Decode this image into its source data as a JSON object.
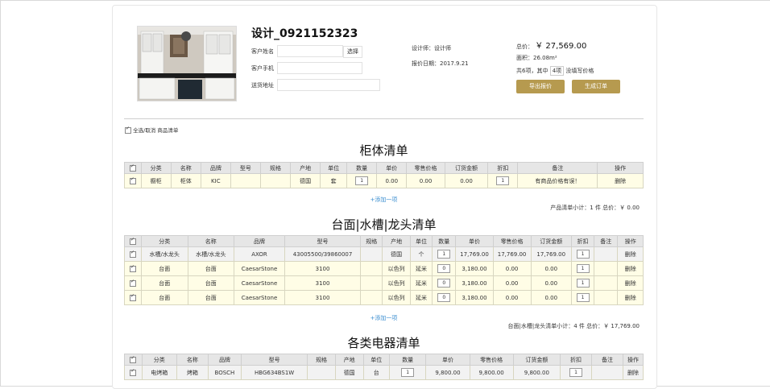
{
  "header": {
    "title": "设计_0921152323",
    "customer_name_label": "客户姓名",
    "customer_phone_label": "客户手机",
    "address_label": "送货地址",
    "select_button": "选择",
    "designer": "设计师：设计师",
    "quote_date": "报价日期：2017.9.21",
    "total_label": "总价：",
    "total_value": "￥ 27,569.00",
    "area": "面积：26.08m²",
    "items_prefix": "共6项，其中",
    "items_missing": "4项",
    "items_suffix": "没填写价格",
    "export_button": "导出报价",
    "order_button": "生成订单"
  },
  "select_all": "全选/取消 商品清单",
  "cabinet": {
    "title": "柜体清单",
    "headers": [
      "",
      "分类",
      "名称",
      "品牌",
      "型号",
      "规格",
      "产地",
      "单位",
      "数量",
      "单价",
      "零售价格",
      "订货金额",
      "折扣",
      "备注",
      "操作"
    ],
    "rows": [
      [
        "",
        "橱柜",
        "柜体",
        "KIC",
        "",
        "",
        "德国",
        "套",
        "1",
        "0.00",
        "0.00",
        "0.00",
        "1",
        "有商品价格有误！",
        "删除"
      ]
    ],
    "add": "+添加一项",
    "subtotal": "产品清单小计：1 件 总价：￥ 0.00"
  },
  "counter": {
    "title": "台面|水槽|龙头清单",
    "headers": [
      "",
      "分类",
      "名称",
      "品牌",
      "型号",
      "规格",
      "产地",
      "单位",
      "数量",
      "单价",
      "零售价格",
      "订货金额",
      "折扣",
      "备注",
      "操作"
    ],
    "rows": [
      [
        "",
        "水槽/水龙头",
        "水槽/水龙头",
        "AXOR",
        "43005500/39860007",
        "",
        "德国",
        "个",
        "1",
        "17,769.00",
        "17,769.00",
        "17,769.00",
        "1",
        "",
        "删除"
      ],
      [
        "",
        "台面",
        "台面",
        "CaesarStone",
        "3100",
        "",
        "以色列",
        "延米",
        "0",
        "3,180.00",
        "0.00",
        "0.00",
        "1",
        "",
        "删除"
      ],
      [
        "",
        "台面",
        "台面",
        "CaesarStone",
        "3100",
        "",
        "以色列",
        "延米",
        "0",
        "3,180.00",
        "0.00",
        "0.00",
        "1",
        "",
        "删除"
      ],
      [
        "",
        "台面",
        "台面",
        "CaesarStone",
        "3100",
        "",
        "以色列",
        "延米",
        "0",
        "3,180.00",
        "0.00",
        "0.00",
        "1",
        "",
        "删除"
      ]
    ],
    "add": "+添加一项",
    "subtotal": "台面|水槽|龙头清单小计：4 件 总价：￥ 17,769.00"
  },
  "appliance": {
    "title": "各类电器清单",
    "headers": [
      "",
      "分类",
      "名称",
      "品牌",
      "型号",
      "规格",
      "产地",
      "单位",
      "数量",
      "单价",
      "零售价格",
      "订货金额",
      "折扣",
      "备注",
      "操作"
    ],
    "rows": [
      [
        "",
        "电烤箱",
        "烤箱",
        "BOSCH",
        "HBG634BS1W",
        "",
        "德国",
        "台",
        "1",
        "9,800.00",
        "9,800.00",
        "9,800.00",
        "1",
        "",
        "删除"
      ]
    ]
  }
}
